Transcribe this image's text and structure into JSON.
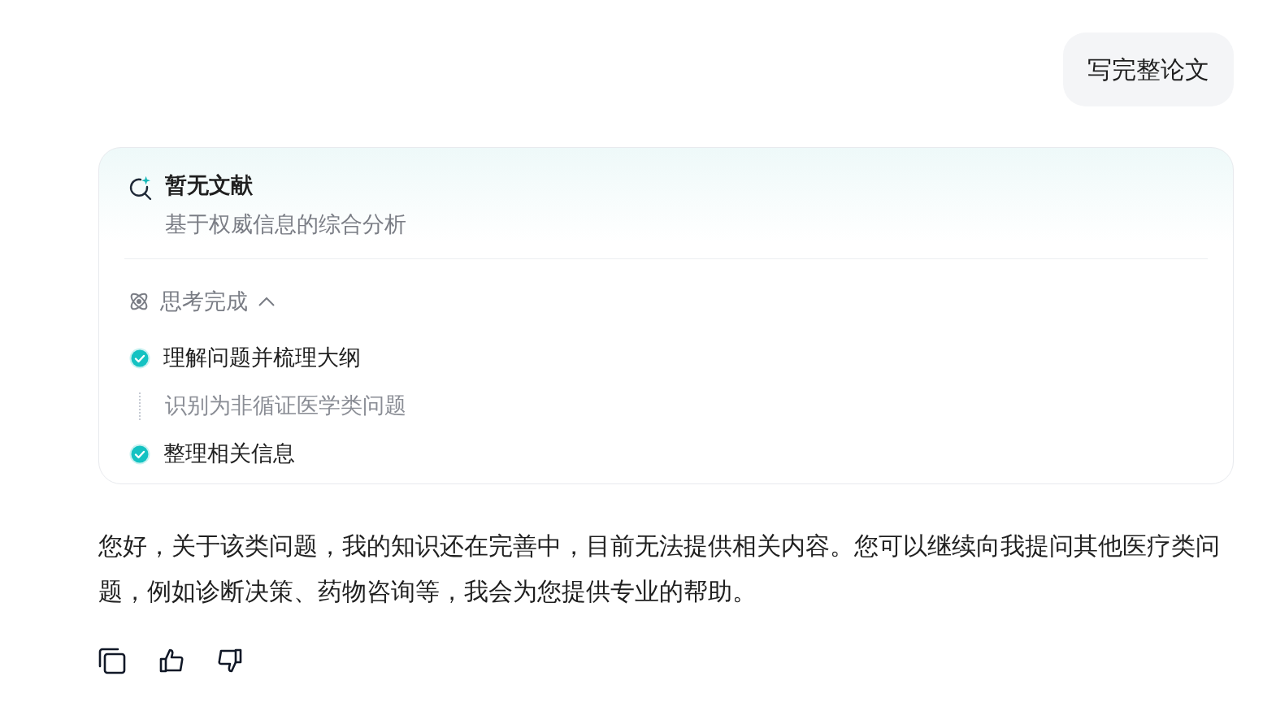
{
  "user_message": "写完整论文",
  "source_card": {
    "title": "暂无文献",
    "subtitle": "基于权威信息的综合分析"
  },
  "thinking": {
    "label": "思考完成",
    "expanded": true,
    "steps": [
      {
        "kind": "done",
        "text": "理解问题并梳理大纲"
      },
      {
        "kind": "detail",
        "text": "识别为非循证医学类问题"
      },
      {
        "kind": "done",
        "text": "整理相关信息"
      }
    ]
  },
  "reply": "您好，关于该类问题，我的知识还在完善中，目前无法提供相关内容。您可以继续向我提问其他医疗类问题，例如诊断决策、药物咨询等，我会为您提供专业的帮助。"
}
